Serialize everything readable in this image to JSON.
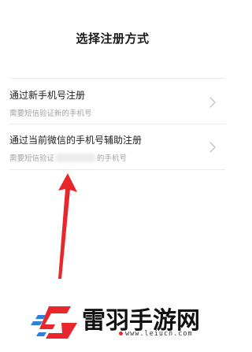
{
  "page_title": "选择注册方式",
  "options": [
    {
      "title": "通过新手机号注册",
      "subtitle": "需要短信验证新的手机号"
    },
    {
      "title": "通过当前微信的手机号辅助注册",
      "subtitle_before": "需要短信验证",
      "subtitle_after": "的手机号"
    }
  ],
  "icons": {
    "chevron": "chevron-right-icon",
    "arrow": "arrow-up-icon"
  },
  "watermark": {
    "name": "雷羽手游网",
    "url": "www.leiucn.com"
  },
  "colors": {
    "arrow": "#e8262b",
    "logo_red": "#e8262b",
    "logo_blue": "#2f7fd8",
    "divider": "#e9e9e9",
    "subtitle": "#a3a3a3"
  }
}
